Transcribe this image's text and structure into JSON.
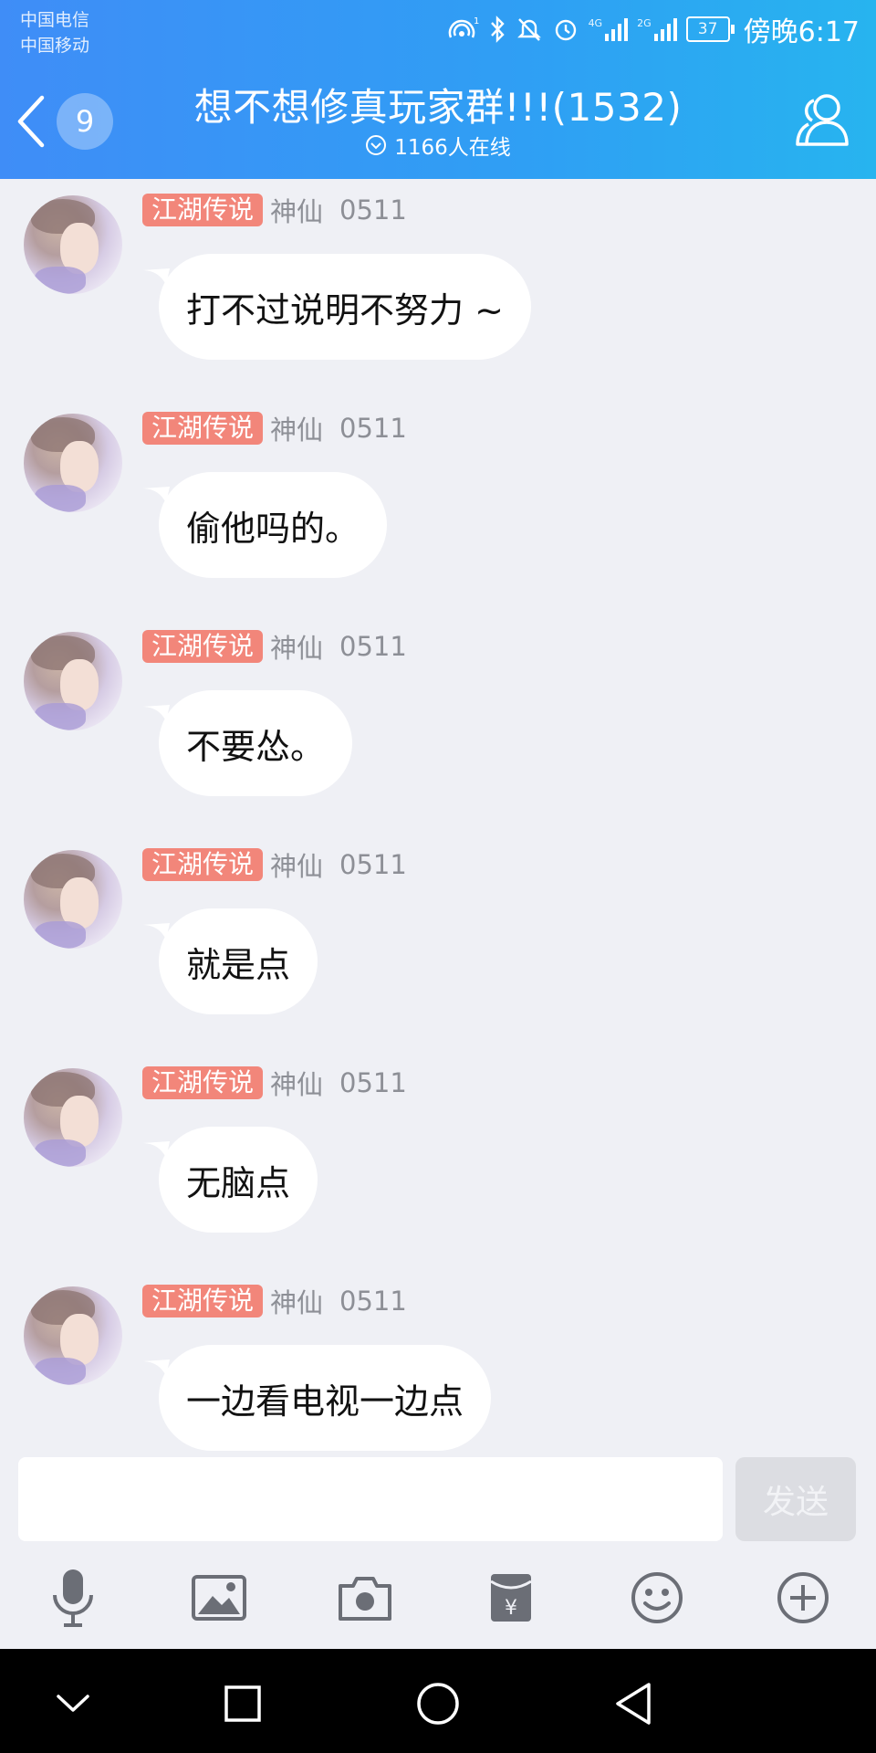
{
  "status_bar": {
    "carrier_1": "中国电信",
    "carrier_2": "中国移动",
    "net_1": "4G",
    "net_2": "2G",
    "battery": "37",
    "time": "傍晚6:17"
  },
  "header": {
    "unread_count": "9",
    "title": "想不想修真玩家群!!!(1532)",
    "online": "1166人在线"
  },
  "messages": [
    {
      "tag": "江湖传说",
      "level": "神仙",
      "time": "0511",
      "text": "打不过说明不努力 ~"
    },
    {
      "tag": "江湖传说",
      "level": "神仙",
      "time": "0511",
      "text": "偷他吗的。"
    },
    {
      "tag": "江湖传说",
      "level": "神仙",
      "time": "0511",
      "text": "不要怂。"
    },
    {
      "tag": "江湖传说",
      "level": "神仙",
      "time": "0511",
      "text": "就是点"
    },
    {
      "tag": "江湖传说",
      "level": "神仙",
      "time": "0511",
      "text": "无脑点"
    },
    {
      "tag": "江湖传说",
      "level": "神仙",
      "time": "0511",
      "text": "一边看电视一边点"
    }
  ],
  "input": {
    "value": "",
    "send_label": "发送"
  },
  "toolbar": [
    "microphone-icon",
    "image-icon",
    "camera-icon",
    "red-packet-icon",
    "emoji-icon",
    "plus-icon"
  ],
  "colors": {
    "header_start": "#3f8df7",
    "header_end": "#27b4ef",
    "tag_bg": "#f2867a",
    "chat_bg": "#eff0f5"
  }
}
